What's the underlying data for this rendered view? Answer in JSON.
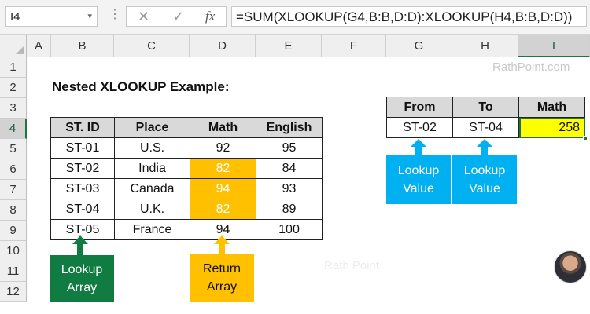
{
  "formula_bar": {
    "name_box": "I4",
    "name_box_arrow": "▾",
    "dots": "⋮",
    "cancel_glyph": "✕",
    "enter_glyph": "✓",
    "fx_glyph": "fx",
    "formula": "=SUM(XLOOKUP(G4,B:B,D:D):XLOOKUP(H4,B:B,D:D))"
  },
  "columns": [
    "A",
    "B",
    "C",
    "D",
    "E",
    "F",
    "G",
    "H",
    "I"
  ],
  "selected_column": "I",
  "rows": [
    "1",
    "2",
    "3",
    "4",
    "5",
    "6",
    "7",
    "8",
    "9",
    "10",
    "11",
    "12"
  ],
  "selected_row": "4",
  "watermark": "RathPoint.com",
  "watermark_faint": "Rath Point",
  "title": "Nested XLOOKUP Example:",
  "main_table": {
    "headers": [
      "ST. ID",
      "Place",
      "Math",
      "English"
    ],
    "rows": [
      [
        "ST-01",
        "U.S.",
        "92",
        "95"
      ],
      [
        "ST-02",
        "India",
        "82",
        "84"
      ],
      [
        "ST-03",
        "Canada",
        "94",
        "93"
      ],
      [
        "ST-04",
        "U.K.",
        "82",
        "89"
      ],
      [
        "ST-05",
        "France",
        "94",
        "100"
      ]
    ]
  },
  "lookup_table": {
    "headers": [
      "From",
      "To",
      "Math"
    ],
    "row": [
      "ST-02",
      "ST-04",
      "258"
    ]
  },
  "callouts": {
    "lookup_array": [
      "Lookup",
      "Array"
    ],
    "return_array": [
      "Return",
      "Array"
    ],
    "lookup_value_1": [
      "Lookup",
      "Value"
    ],
    "lookup_value_2": [
      "Lookup",
      "Value"
    ]
  },
  "colors": {
    "excel_green": "#217346",
    "highlight_orange": "#ffc000",
    "result_yellow": "#ffff00",
    "callout_blue": "#00b0f0",
    "callout_green": "#107c41"
  }
}
